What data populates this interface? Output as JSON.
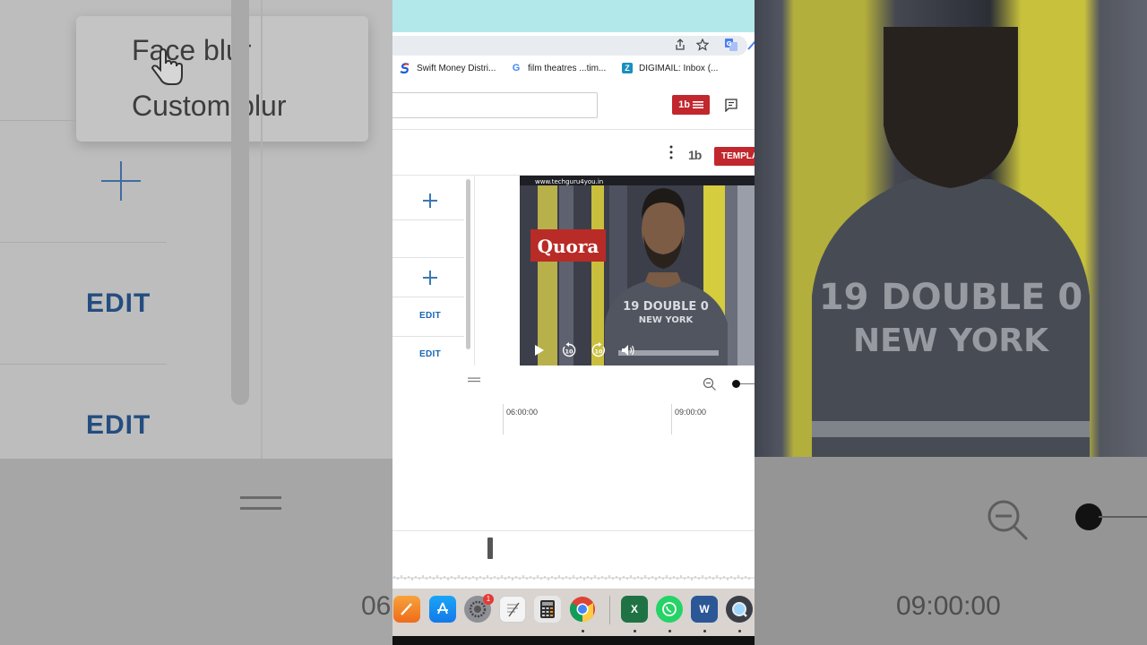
{
  "browser": {
    "bookmarks": [
      {
        "label": "Swift Money Distri...",
        "icon": "swift-icon"
      },
      {
        "label": "film theatres ...tim...",
        "icon": "google-icon"
      },
      {
        "label": "DIGIMAIL: Inbox (...",
        "icon": "zoho-icon"
      }
    ]
  },
  "youtube": {
    "menu_button_label": "1b",
    "template_button_label": "TEMPLA",
    "tb_logo": "1b"
  },
  "left_panel": {
    "edit_label": "EDIT"
  },
  "blur_menu": {
    "items": [
      "Face blur",
      "Custom blur"
    ]
  },
  "video": {
    "watermark": "www.techguru4you.in",
    "logo_text": "Quora",
    "shirt_line1": "19 DOUBLE 0",
    "shirt_line2": "NEW YORK",
    "rewind_label": "10",
    "forward_label": "10"
  },
  "timeline": {
    "labels": [
      "06:00:00",
      "09:00:00"
    ],
    "zoom_level": 0.1
  },
  "background": {
    "left_time": "06",
    "right_time": "09:00:00",
    "shirt_line1": "19 DOUBLE 0",
    "shirt_line2": "NEW YORK"
  },
  "dock": {
    "apps": [
      "pages",
      "app-store",
      "system-preferences",
      "textedit",
      "calculator",
      "chrome",
      "excel",
      "whatsapp",
      "word",
      "quicktime"
    ],
    "system_prefs_badge": "1"
  },
  "colors": {
    "browser_top": "#b3e8eb",
    "yt_red": "#c1272d",
    "edit_blue": "#1a67b3",
    "quora_red": "#b92b27"
  }
}
